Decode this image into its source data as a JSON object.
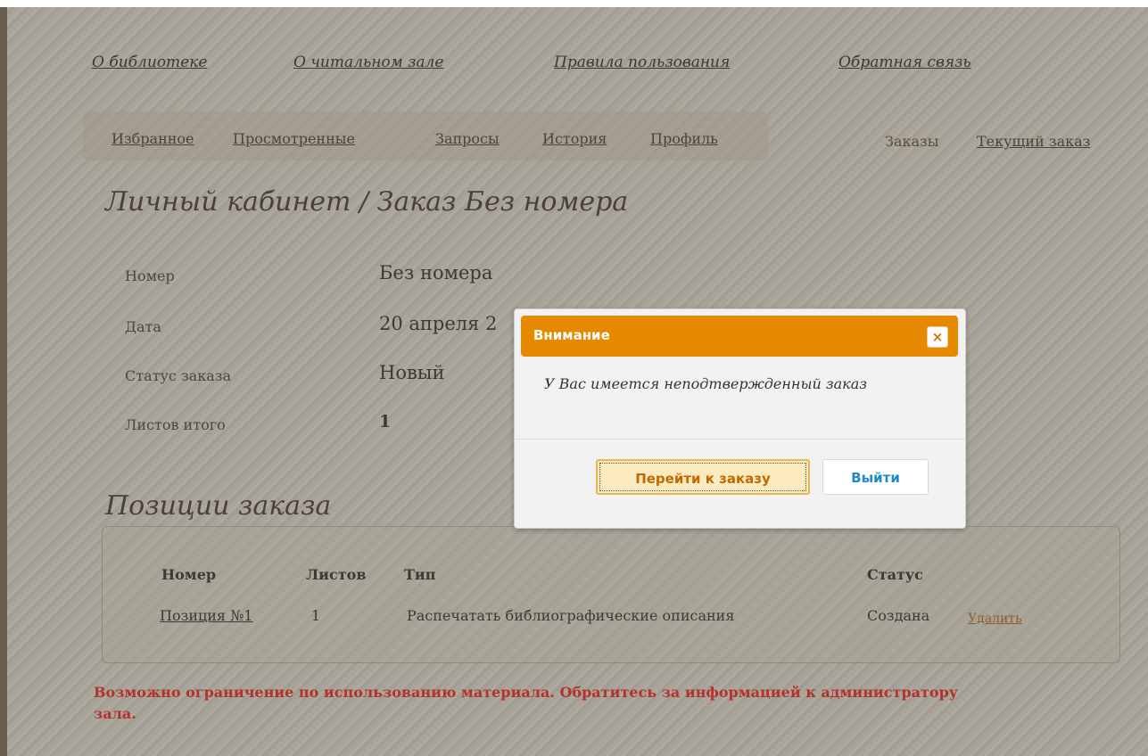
{
  "top_nav": [
    "О библиотеке",
    "О читальном зале",
    "Правила пользования",
    "Обратная связь"
  ],
  "sub_nav": [
    "Избранное",
    "Просмотренные",
    "Запросы",
    "История",
    "Профиль"
  ],
  "right_nav": {
    "orders": "Заказы",
    "current_order": "Текущий заказ"
  },
  "page_title": "Личный кабинет / Заказ Без номера",
  "order_info": {
    "number": {
      "label": "Номер",
      "value": "Без номера"
    },
    "date": {
      "label": "Дата",
      "value": "20 апреля 2"
    },
    "status": {
      "label": "Статус заказа",
      "value": "Новый"
    },
    "sheets": {
      "label": "Листов итого",
      "value": "1"
    }
  },
  "positions_title": "Позиции заказа",
  "table": {
    "headers": {
      "number": "Номер",
      "sheets": "Листов",
      "type": "Тип",
      "status": "Статус"
    },
    "rows": [
      {
        "number": "Позиция №1",
        "sheets": "1",
        "type": "Распечатать библиографические описания",
        "status": "Создана",
        "action": "Удалить"
      }
    ]
  },
  "warning": "Возможно ограничение по использованию материала. Обратитесь за информацией к администратору зала.",
  "modal": {
    "title": "Внимание",
    "close": "×",
    "message": "У Вас имеется неподтвержденный заказ",
    "go_to_order": "Перейти к заказу",
    "exit": "Выйти"
  },
  "colors": {
    "modal_header": "#e58a00",
    "warning": "#b3322d",
    "exit_button_text": "#1f8ac8"
  }
}
